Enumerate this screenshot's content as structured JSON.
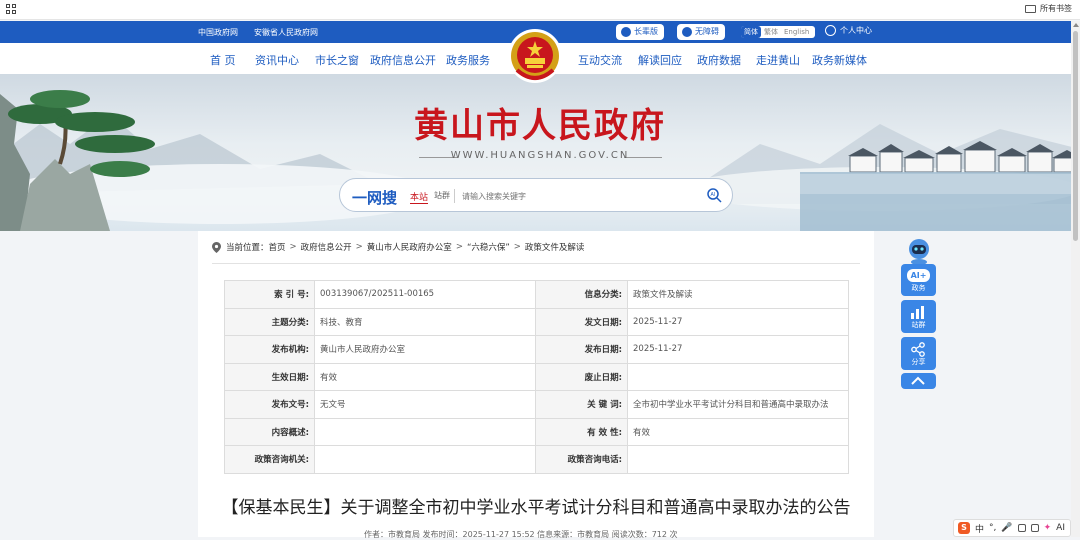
{
  "browser": {
    "bookmarks_all": "所有书签"
  },
  "topbar": {
    "link_gov_cn": "中国政府网",
    "link_anhui": "安徽省人民政府网",
    "elder_mode": "长辈版",
    "accessible": "无障碍",
    "lang": [
      "简体",
      "繁体",
      "English"
    ],
    "personal_center": "个人中心"
  },
  "nav": [
    "首 页",
    "资讯中心",
    "市长之窗",
    "政府信息公开",
    "政务服务",
    "互动交流",
    "解读回应",
    "政府数据",
    "走进黄山",
    "政务新媒体"
  ],
  "banner": {
    "title": "黄山市人民政府",
    "url": "WWW.HUANGSHAN.GOV.CN"
  },
  "search": {
    "brand": "一网搜",
    "scope_site": "本站",
    "scope_group": "站群",
    "placeholder": "请输入搜索关键字"
  },
  "breadcrumb": [
    "当前位置：",
    "首页",
    "政府信息公开",
    "黄山市人民政府办公室",
    "“六稳六保”",
    "政策文件及解读"
  ],
  "meta": [
    [
      "索 引 号:",
      "003139067/202511-00165",
      "信息分类:",
      "政策文件及解读"
    ],
    [
      "主题分类:",
      "科技、教育",
      "发文日期:",
      "2025-11-27"
    ],
    [
      "发布机构:",
      "黄山市人民政府办公室",
      "发布日期:",
      "2025-11-27"
    ],
    [
      "生效日期:",
      "有效",
      "废止日期:",
      ""
    ],
    [
      "发布文号:",
      "无文号",
      "关 键 词:",
      "全市初中学业水平考试计分科目和普通高中录取办法"
    ],
    [
      "内容概述:",
      "",
      "有 效 性:",
      "有效"
    ],
    [
      "政策咨询机关:",
      "",
      "政策咨询电话:",
      ""
    ]
  ],
  "document": {
    "title": "【保基本民生】关于调整全市初中学业水平考试计分科目和普通高中录取办法的公告",
    "info": "作者：市教育局    发布时间：2025-11-27 15:52    信息来源：市教育局    阅读次数：712 次"
  },
  "tools": {
    "ai": "AI+\n政务",
    "site_group": "站群",
    "share": "分享"
  },
  "ime": {
    "logo": "S",
    "mode": "中"
  },
  "colors": {
    "primary_blue": "#1e5cc0",
    "title_red": "#c8161d",
    "tool_blue": "#3a86e6"
  }
}
